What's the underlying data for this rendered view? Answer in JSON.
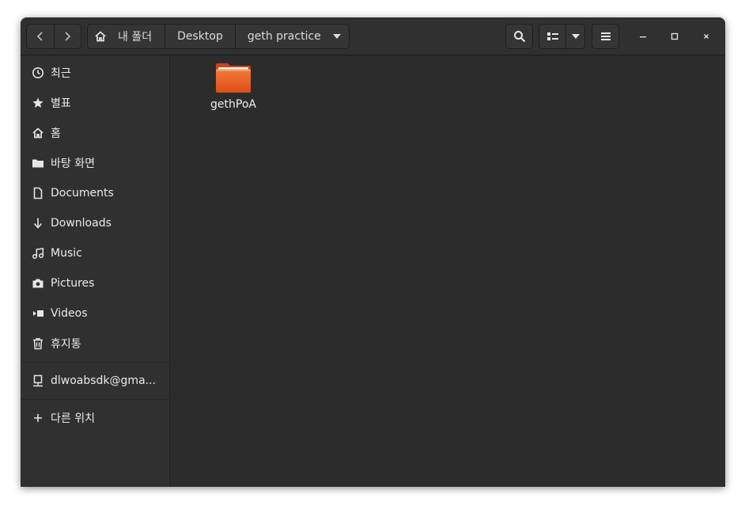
{
  "breadcrumbs": {
    "home_label": "내 폴더",
    "items": [
      "Desktop",
      "geth practice"
    ]
  },
  "sidebar": {
    "items": [
      {
        "label": "최근",
        "icon": "clock-icon"
      },
      {
        "label": "별표",
        "icon": "star-icon"
      },
      {
        "label": "홈",
        "icon": "home-icon"
      },
      {
        "label": "바탕 화면",
        "icon": "folder-icon"
      },
      {
        "label": "Documents",
        "icon": "document-icon"
      },
      {
        "label": "Downloads",
        "icon": "download-icon"
      },
      {
        "label": "Music",
        "icon": "music-icon"
      },
      {
        "label": "Pictures",
        "icon": "camera-icon"
      },
      {
        "label": "Videos",
        "icon": "video-icon"
      },
      {
        "label": "휴지통",
        "icon": "trash-icon"
      }
    ],
    "network": {
      "label": "dlwoabsdk@gma...",
      "icon": "network-drive-icon"
    },
    "other": {
      "label": "다른 위치",
      "icon": "plus-icon"
    }
  },
  "files": [
    {
      "name": "gethPoA",
      "icon": "folder-icon"
    }
  ],
  "colors": {
    "accent": "#e95420",
    "background": "#2c2c2c",
    "headerbar": "#303030",
    "text": "#eaeaea"
  }
}
